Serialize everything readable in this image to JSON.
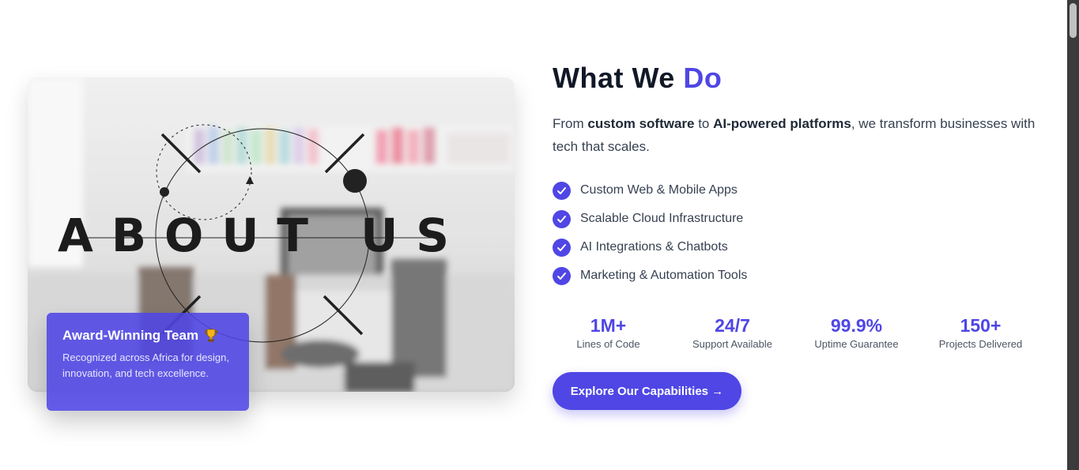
{
  "about_image": {
    "overlay_text": "ABOUT US"
  },
  "award": {
    "title": "Award-Winning Team",
    "trophy_icon": "trophy-icon",
    "description": "Recognized across Africa for design, innovation, and tech excellence."
  },
  "section": {
    "heading_main": "What We",
    "heading_accent": "Do",
    "intro_parts": {
      "p1": "From ",
      "b1": "custom software",
      "p2": " to ",
      "b2": "AI-powered platforms",
      "p3": ", we transform businesses with tech that scales."
    }
  },
  "features": [
    {
      "label": "Custom Web & Mobile Apps",
      "icon": "check-circle-icon"
    },
    {
      "label": "Scalable Cloud Infrastructure",
      "icon": "check-circle-icon"
    },
    {
      "label": "AI Integrations & Chatbots",
      "icon": "check-circle-icon"
    },
    {
      "label": "Marketing & Automation Tools",
      "icon": "check-circle-icon"
    }
  ],
  "stats": [
    {
      "value": "1M+",
      "label": "Lines of Code"
    },
    {
      "value": "24/7",
      "label": "Support Available"
    },
    {
      "value": "99.9%",
      "label": "Uptime Guarantee"
    },
    {
      "value": "150+",
      "label": "Projects Delivered"
    }
  ],
  "cta": {
    "label": "Explore Our Capabilities →"
  },
  "colors": {
    "accent": "#4f46e5",
    "heading": "#111827",
    "body_text": "#374151"
  }
}
